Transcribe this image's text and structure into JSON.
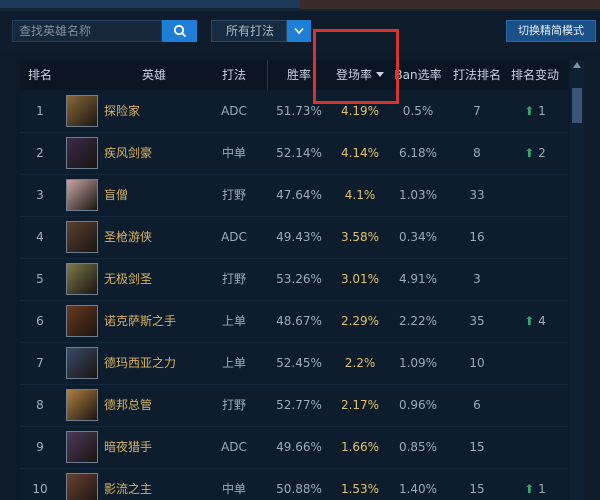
{
  "search": {
    "placeholder": "查找英雄名称"
  },
  "filter": {
    "selected": "所有打法"
  },
  "switch_button": {
    "label": "切换精简模式"
  },
  "columns": {
    "rank": "排名",
    "hero": "英雄",
    "role": "打法",
    "win_rate": "胜率",
    "pick_rate": "登场率",
    "ban_rate": "Ban选率",
    "role_rank": "打法排名",
    "rank_change": "排名变动"
  },
  "rows": [
    {
      "rank": "1",
      "name": "探险家",
      "role": "ADC",
      "win_rate": "51.73%",
      "pick_rate": "4.19%",
      "ban_rate": "0.5%",
      "role_rank": "7",
      "change": "1",
      "change_dir": "up",
      "avatar_color": "#8a6a3a"
    },
    {
      "rank": "2",
      "name": "疾风剑豪",
      "role": "中单",
      "win_rate": "52.14%",
      "pick_rate": "4.14%",
      "ban_rate": "6.18%",
      "role_rank": "8",
      "change": "2",
      "change_dir": "up",
      "avatar_color": "#3b2a4a"
    },
    {
      "rank": "3",
      "name": "盲僧",
      "role": "打野",
      "win_rate": "47.64%",
      "pick_rate": "4.1%",
      "ban_rate": "1.03%",
      "role_rank": "33",
      "change": "",
      "change_dir": "",
      "avatar_color": "#c9a6a6"
    },
    {
      "rank": "4",
      "name": "圣枪游侠",
      "role": "ADC",
      "win_rate": "49.43%",
      "pick_rate": "3.58%",
      "ban_rate": "0.34%",
      "role_rank": "16",
      "change": "",
      "change_dir": "",
      "avatar_color": "#5a4030"
    },
    {
      "rank": "5",
      "name": "无极剑圣",
      "role": "打野",
      "win_rate": "53.26%",
      "pick_rate": "3.01%",
      "ban_rate": "4.91%",
      "role_rank": "3",
      "change": "",
      "change_dir": "",
      "avatar_color": "#7a7a4a"
    },
    {
      "rank": "6",
      "name": "诺克萨斯之手",
      "role": "上单",
      "win_rate": "48.67%",
      "pick_rate": "2.29%",
      "ban_rate": "2.22%",
      "role_rank": "35",
      "change": "4",
      "change_dir": "up",
      "avatar_color": "#6a3a20"
    },
    {
      "rank": "7",
      "name": "德玛西亚之力",
      "role": "上单",
      "win_rate": "52.45%",
      "pick_rate": "2.2%",
      "ban_rate": "1.09%",
      "role_rank": "10",
      "change": "",
      "change_dir": "",
      "avatar_color": "#3a4a6a"
    },
    {
      "rank": "8",
      "name": "德邦总管",
      "role": "打野",
      "win_rate": "52.77%",
      "pick_rate": "2.17%",
      "ban_rate": "0.96%",
      "role_rank": "6",
      "change": "",
      "change_dir": "",
      "avatar_color": "#b08040"
    },
    {
      "rank": "9",
      "name": "暗夜猎手",
      "role": "ADC",
      "win_rate": "49.66%",
      "pick_rate": "1.66%",
      "ban_rate": "0.85%",
      "role_rank": "15",
      "change": "",
      "change_dir": "",
      "avatar_color": "#4a3a5a"
    },
    {
      "rank": "10",
      "name": "影流之主",
      "role": "中单",
      "win_rate": "50.88%",
      "pick_rate": "1.53%",
      "ban_rate": "1.40%",
      "role_rank": "15",
      "change": "1",
      "change_dir": "up",
      "avatar_color": "#6a4030"
    }
  ]
}
